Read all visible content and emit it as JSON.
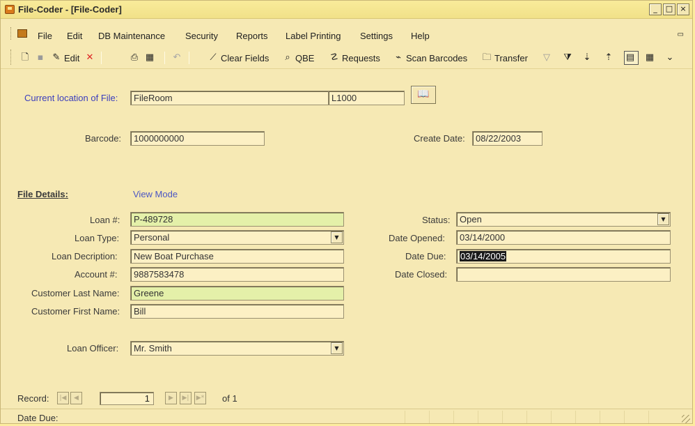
{
  "window": {
    "title": "File-Coder - [File-Coder]",
    "controls": {
      "minimize": "_",
      "maximize": "□",
      "close": "×"
    }
  },
  "menu": {
    "items": [
      "File",
      "Edit",
      "DB Maintenance",
      "Security",
      "Reports",
      "Label Printing",
      "Settings",
      "Help"
    ]
  },
  "toolbar": {
    "edit": "Edit",
    "clear_fields": "Clear Fields",
    "qbe": "QBE",
    "requests": "Requests",
    "scan_barcodes": "Scan Barcodes",
    "transfer": "Transfer"
  },
  "location": {
    "label": "Current location of File:",
    "name": "FileRoom",
    "code": "L1000"
  },
  "barcode": {
    "label": "Barcode:",
    "value": "1000000000"
  },
  "create_date": {
    "label": "Create Date:",
    "value": "08/22/2003"
  },
  "file_details": {
    "title": "File Details:",
    "mode": "View Mode"
  },
  "fields": {
    "loan_no": {
      "label": "Loan #:",
      "value": "P-489728"
    },
    "loan_type": {
      "label": "Loan Type:",
      "value": "Personal"
    },
    "loan_description": {
      "label": "Loan Decription:",
      "value": "New Boat Purchase"
    },
    "account_no": {
      "label": "Account #:",
      "value": "9887583478"
    },
    "customer_last": {
      "label": "Customer Last Name:",
      "value": "Greene"
    },
    "customer_first": {
      "label": "Customer First Name:",
      "value": "Bill"
    },
    "loan_officer": {
      "label": "Loan Officer:",
      "value": "Mr. Smith"
    },
    "status": {
      "label": "Status:",
      "value": "Open"
    },
    "date_opened": {
      "label": "Date Opened:",
      "value": "03/14/2000"
    },
    "date_due": {
      "label": "Date Due:",
      "value": "03/14/2005"
    },
    "date_closed": {
      "label": "Date Closed:",
      "value": ""
    }
  },
  "record_nav": {
    "label": "Record:",
    "current": "1",
    "of": "of  1"
  },
  "status_bar": {
    "text": "Date Due:"
  },
  "colors": {
    "background": "#f6e9b4",
    "accent_label": "#3b3ebd",
    "required_field": "#e4f0a9"
  }
}
